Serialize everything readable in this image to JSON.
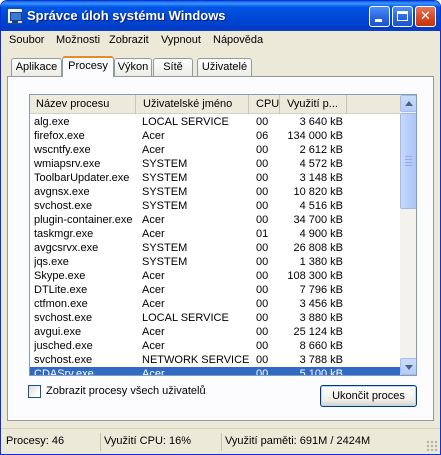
{
  "window": {
    "title": "Správce úloh systému Windows"
  },
  "menu": [
    "Soubor",
    "Možnosti",
    "Zobrazit",
    "Vypnout",
    "Nápověda"
  ],
  "tabs": [
    {
      "label": "Aplikace",
      "active": false
    },
    {
      "label": "Procesy",
      "active": true
    },
    {
      "label": "Výkon",
      "active": false
    },
    {
      "label": "Sítě",
      "active": false
    },
    {
      "label": "Uživatelé",
      "active": false
    }
  ],
  "columns": [
    "Název procesu",
    "Uživatelské jméno",
    "CPU",
    "Využití p..."
  ],
  "rows": [
    {
      "name": "alg.exe",
      "user": "LOCAL SERVICE",
      "cpu": "00",
      "mem": "3 640 kB"
    },
    {
      "name": "firefox.exe",
      "user": "Acer",
      "cpu": "06",
      "mem": "134 000 kB"
    },
    {
      "name": "wscntfy.exe",
      "user": "Acer",
      "cpu": "00",
      "mem": "2 612 kB"
    },
    {
      "name": "wmiapsrv.exe",
      "user": "SYSTEM",
      "cpu": "00",
      "mem": "4 572 kB"
    },
    {
      "name": "ToolbarUpdater.exe",
      "user": "SYSTEM",
      "cpu": "00",
      "mem": "3 148 kB"
    },
    {
      "name": "avgnsx.exe",
      "user": "SYSTEM",
      "cpu": "00",
      "mem": "10 820 kB"
    },
    {
      "name": "svchost.exe",
      "user": "SYSTEM",
      "cpu": "00",
      "mem": "4 516 kB"
    },
    {
      "name": "plugin-container.exe",
      "user": "Acer",
      "cpu": "00",
      "mem": "34 700 kB"
    },
    {
      "name": "taskmgr.exe",
      "user": "Acer",
      "cpu": "01",
      "mem": "4 900 kB"
    },
    {
      "name": "avgcsrvx.exe",
      "user": "SYSTEM",
      "cpu": "00",
      "mem": "26 808 kB"
    },
    {
      "name": "jqs.exe",
      "user": "SYSTEM",
      "cpu": "00",
      "mem": "1 380 kB"
    },
    {
      "name": "Skype.exe",
      "user": "Acer",
      "cpu": "00",
      "mem": "108 300 kB"
    },
    {
      "name": "DTLite.exe",
      "user": "Acer",
      "cpu": "00",
      "mem": "7 796 kB"
    },
    {
      "name": "ctfmon.exe",
      "user": "Acer",
      "cpu": "00",
      "mem": "3 456 kB"
    },
    {
      "name": "svchost.exe",
      "user": "LOCAL SERVICE",
      "cpu": "00",
      "mem": "3 880 kB"
    },
    {
      "name": "avgui.exe",
      "user": "Acer",
      "cpu": "00",
      "mem": "25 124 kB"
    },
    {
      "name": "jusched.exe",
      "user": "Acer",
      "cpu": "00",
      "mem": "8 660 kB"
    },
    {
      "name": "svchost.exe",
      "user": "NETWORK SERVICE",
      "cpu": "00",
      "mem": "3 788 kB"
    },
    {
      "name": "CDASrv.exe",
      "user": "Acer",
      "cpu": "00",
      "mem": "5 100 kB",
      "selected": true
    }
  ],
  "show_all_users_label": "Zobrazit procesy všech uživatelů",
  "end_process_label": "Ukončit proces",
  "status": {
    "processes": "Procesy: 46",
    "cpu": "Využití CPU: 16%",
    "memory": "Využití paměti: 691M / 2424M"
  },
  "colors": {
    "titlebar": "#0046d5",
    "selection": "#316ac5",
    "active_tab_accent": "#e68b2c"
  }
}
